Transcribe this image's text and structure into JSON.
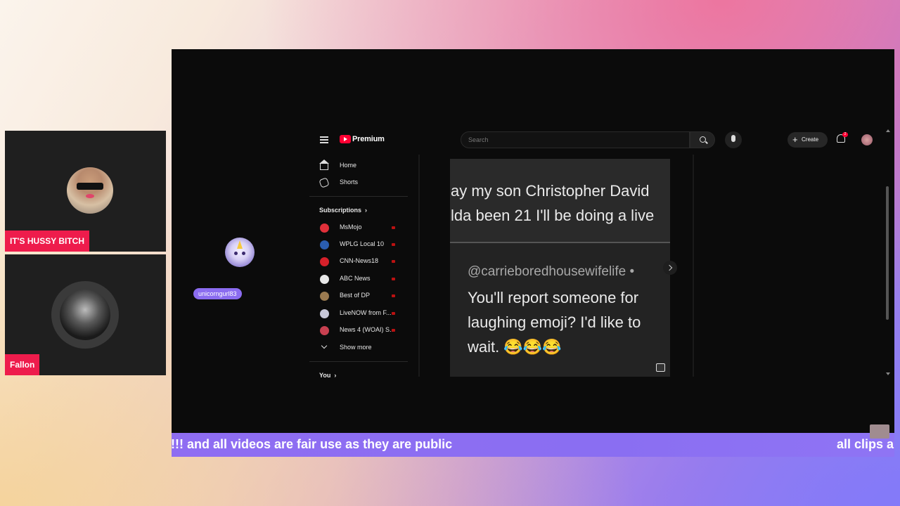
{
  "participants": [
    {
      "name": "IT'S HUSSY BITCH"
    },
    {
      "name": "Fallon"
    }
  ],
  "guest": {
    "username": "unicorngurl83"
  },
  "youtube": {
    "brand": "Premium",
    "search_placeholder": "Search",
    "create_label": "Create",
    "notification_count": "2",
    "nav": [
      {
        "label": "Home",
        "icon": "home-icon"
      },
      {
        "label": "Shorts",
        "icon": "shorts-icon"
      }
    ],
    "subscriptions_heading": "Subscriptions",
    "subscriptions_chevron": "›",
    "channels": [
      {
        "label": "MsMojo",
        "color": "#e0303a"
      },
      {
        "label": "WPLG Local 10",
        "color": "#2a5db0"
      },
      {
        "label": "CNN-News18",
        "color": "#d6202a"
      },
      {
        "label": "ABC News",
        "color": "#e8e8e8"
      },
      {
        "label": "Best of DP",
        "color": "#9a7a50"
      },
      {
        "label": "LiveNOW from F...",
        "color": "#c8c8d8"
      },
      {
        "label": "News 4 (WOAI) S...",
        "color": "#c84050"
      }
    ],
    "show_more": "Show more",
    "you_label": "You",
    "you_chevron": "›"
  },
  "post": {
    "line1": "ay my son Christopher David",
    "line2": "lda been 21 I'll be doing a live",
    "handle": "@carrieboredhousewifelife •",
    "reply": "You'll report someone for laughing emoji? I'd like to wait. 😂😂😂"
  },
  "ticker": {
    "left_text": "!!! and all videos are fair use as they are public",
    "right_text": "all clips a"
  },
  "colors": {
    "name_tag": "#ee1c4c",
    "ticker": "#8a6ef2",
    "guest_label": "#8b6cf0",
    "youtube_red": "#ff0033"
  }
}
